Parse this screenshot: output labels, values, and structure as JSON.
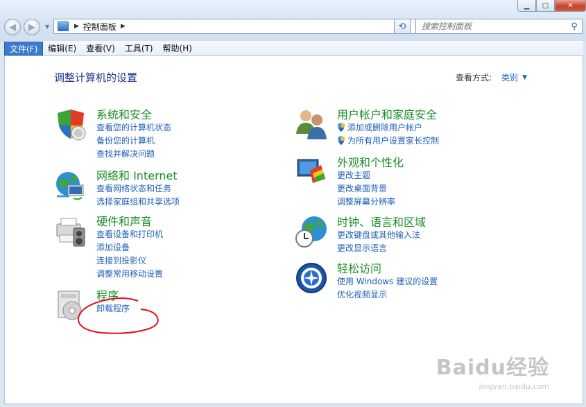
{
  "titlebar": {
    "minimize_glyph": "0",
    "maximize_glyph": "1",
    "close_glyph": "r"
  },
  "nav": {
    "back_glyph": "←",
    "forward_glyph": "→"
  },
  "address": {
    "breadcrumb": "控制面板",
    "icon": "control-panel-icon"
  },
  "search": {
    "placeholder": "搜索控制面板"
  },
  "menu": [
    "文件(F)",
    "编辑(E)",
    "查看(V)",
    "工具(T)",
    "帮助(H)"
  ],
  "main": {
    "title": "调整计算机的设置",
    "view_by_label": "查看方式:",
    "view_by_value": "类别"
  },
  "categories": [
    {
      "title": "系统和安全",
      "icon": "security-shield-icon",
      "links": [
        "查看您的计算机状态",
        "备份您的计算机",
        "查找并解决问题"
      ]
    },
    {
      "title": "网络和 Internet",
      "icon": "network-globe-icon",
      "links": [
        "查看网络状态和任务",
        "选择家庭组和共享选项"
      ]
    },
    {
      "title": "硬件和声音",
      "icon": "printer-speaker-icon",
      "links": [
        "查看设备和打印机",
        "添加设备",
        "连接到投影仪",
        "调整常用移动设置"
      ]
    },
    {
      "title": "程序",
      "icon": "programs-disc-icon",
      "links": [
        "卸载程序"
      ]
    },
    {
      "title": "用户帐户和家庭安全",
      "icon": "users-icon",
      "links": [
        "添加或删除用户帐户",
        "为所有用户设置家长控制"
      ],
      "shielded": [
        true,
        true
      ]
    },
    {
      "title": "外观和个性化",
      "icon": "monitor-palette-icon",
      "links": [
        "更改主题",
        "更改桌面背景",
        "调整屏幕分辨率"
      ]
    },
    {
      "title": "时钟、语言和区域",
      "icon": "clock-globe-icon",
      "links": [
        "更改键盘或其他输入法",
        "更改显示语言"
      ]
    },
    {
      "title": "轻松访问",
      "icon": "ease-of-access-icon",
      "links": [
        "使用 Windows 建议的设置",
        "优化视频显示"
      ]
    }
  ],
  "watermark": {
    "line1": "Baidu经验",
    "line2": "jingyan.baidu.com"
  },
  "colors": {
    "category_title": "#1a8e28",
    "link": "#1d5fb8",
    "page_title": "#1e3287",
    "annotation": "#e0131b"
  }
}
